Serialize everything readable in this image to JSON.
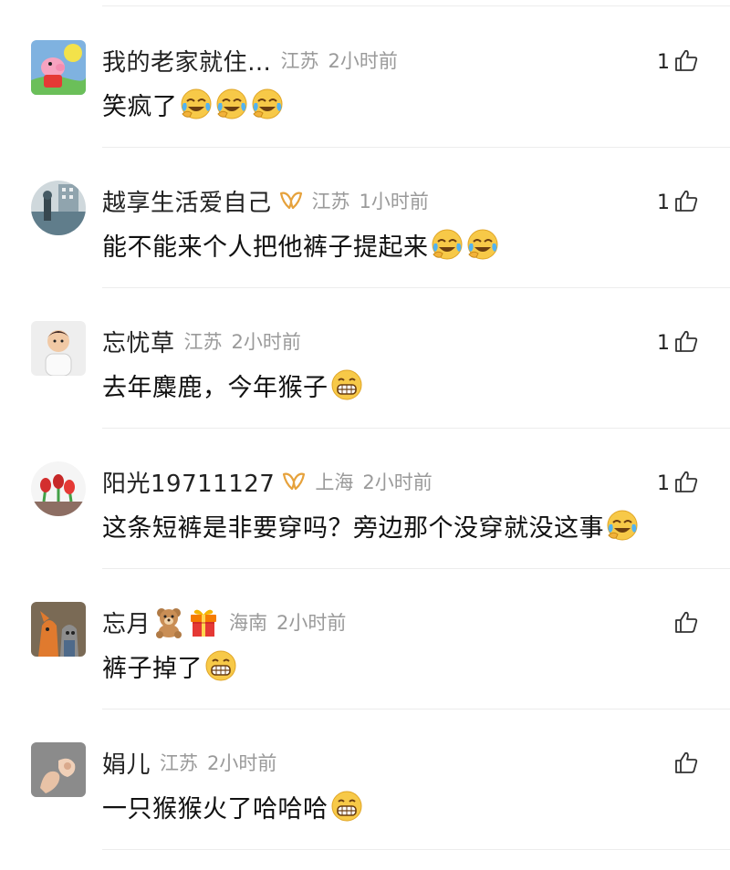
{
  "comments": [
    {
      "username": "我的老家就住…",
      "location": "江苏",
      "time": "2小时前",
      "text": "笑疯了",
      "emojis": [
        "laugh-cry",
        "laugh-cry",
        "laugh-cry"
      ],
      "likes": "1",
      "vip": false,
      "badges": []
    },
    {
      "username": "越享生活爱自己",
      "location": "江苏",
      "time": "1小时前",
      "text": "能不能来个人把他裤子提起来",
      "emojis": [
        "laugh-cry",
        "laugh-cry"
      ],
      "likes": "1",
      "vip": true,
      "badges": []
    },
    {
      "username": "忘忧草",
      "location": "江苏",
      "time": "2小时前",
      "text": "去年麋鹿，今年猴子",
      "emojis": [
        "grin"
      ],
      "likes": "1",
      "vip": false,
      "badges": []
    },
    {
      "username": "阳光19711127",
      "location": "上海",
      "time": "2小时前",
      "text": "这条短裤是非要穿吗？旁边那个没穿就没这事",
      "emojis": [
        "laugh-cry"
      ],
      "likes": "1",
      "vip": true,
      "badges": []
    },
    {
      "username": "忘月",
      "location": "海南",
      "time": "2小时前",
      "text": "裤子掉了",
      "emojis": [
        "grin"
      ],
      "likes": "",
      "vip": false,
      "badges": [
        "teddy-bear",
        "gift-box"
      ]
    },
    {
      "username": "娟儿",
      "location": "江苏",
      "time": "2小时前",
      "text": "一只猴猴火了哈哈哈",
      "emojis": [
        "grin"
      ],
      "likes": "",
      "vip": false,
      "badges": []
    }
  ],
  "colors": {
    "vip_gold": "#e6a23c",
    "meta_gray": "#9a9a9a",
    "emoji_yellow": "#f7c948"
  },
  "icons": {
    "like": "thumbs-up-outline-icon",
    "vip": "vip-ribbon-icon",
    "laugh_cry": "laugh-cry-emoji",
    "grin": "grin-emoji"
  }
}
